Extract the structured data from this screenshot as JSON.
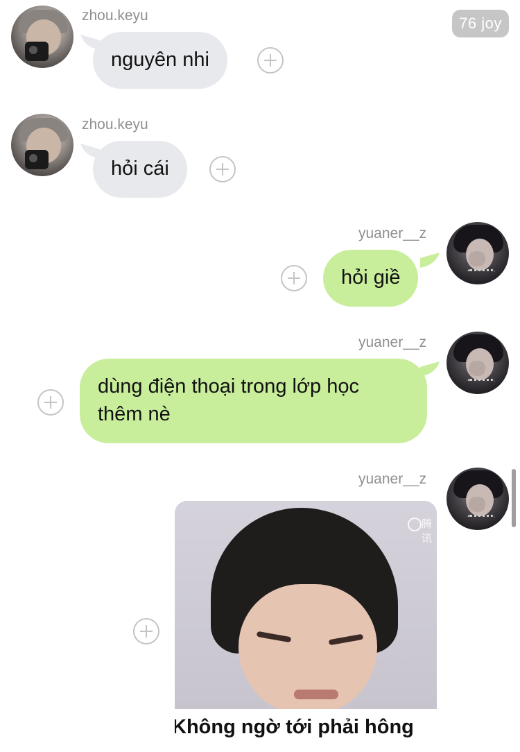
{
  "reaction_badge": "76 joy",
  "messages": [
    {
      "sender": "zhou.keyu",
      "text": "nguyên nhi"
    },
    {
      "sender": "zhou.keyu",
      "text": "hỏi cái"
    },
    {
      "sender": "yuaner__z",
      "text": "hỏi giề"
    },
    {
      "sender": "yuaner__z",
      "text": "dùng điện thoại trong lớp học thêm nè"
    },
    {
      "sender": "yuaner__z",
      "image_caption": "Không ngờ tới phải hông",
      "watermark": "腾讯"
    }
  ],
  "icons": {
    "react": "plus-circle-icon",
    "avatar_left": "avatar-zhou-keyu",
    "avatar_right": "avatar-yuaner-z"
  },
  "colors": {
    "incoming_bubble": "#e8e9ed",
    "outgoing_bubble": "#c9ee9b",
    "username": "#8f8f8f",
    "badge": "#c6c6c6"
  }
}
